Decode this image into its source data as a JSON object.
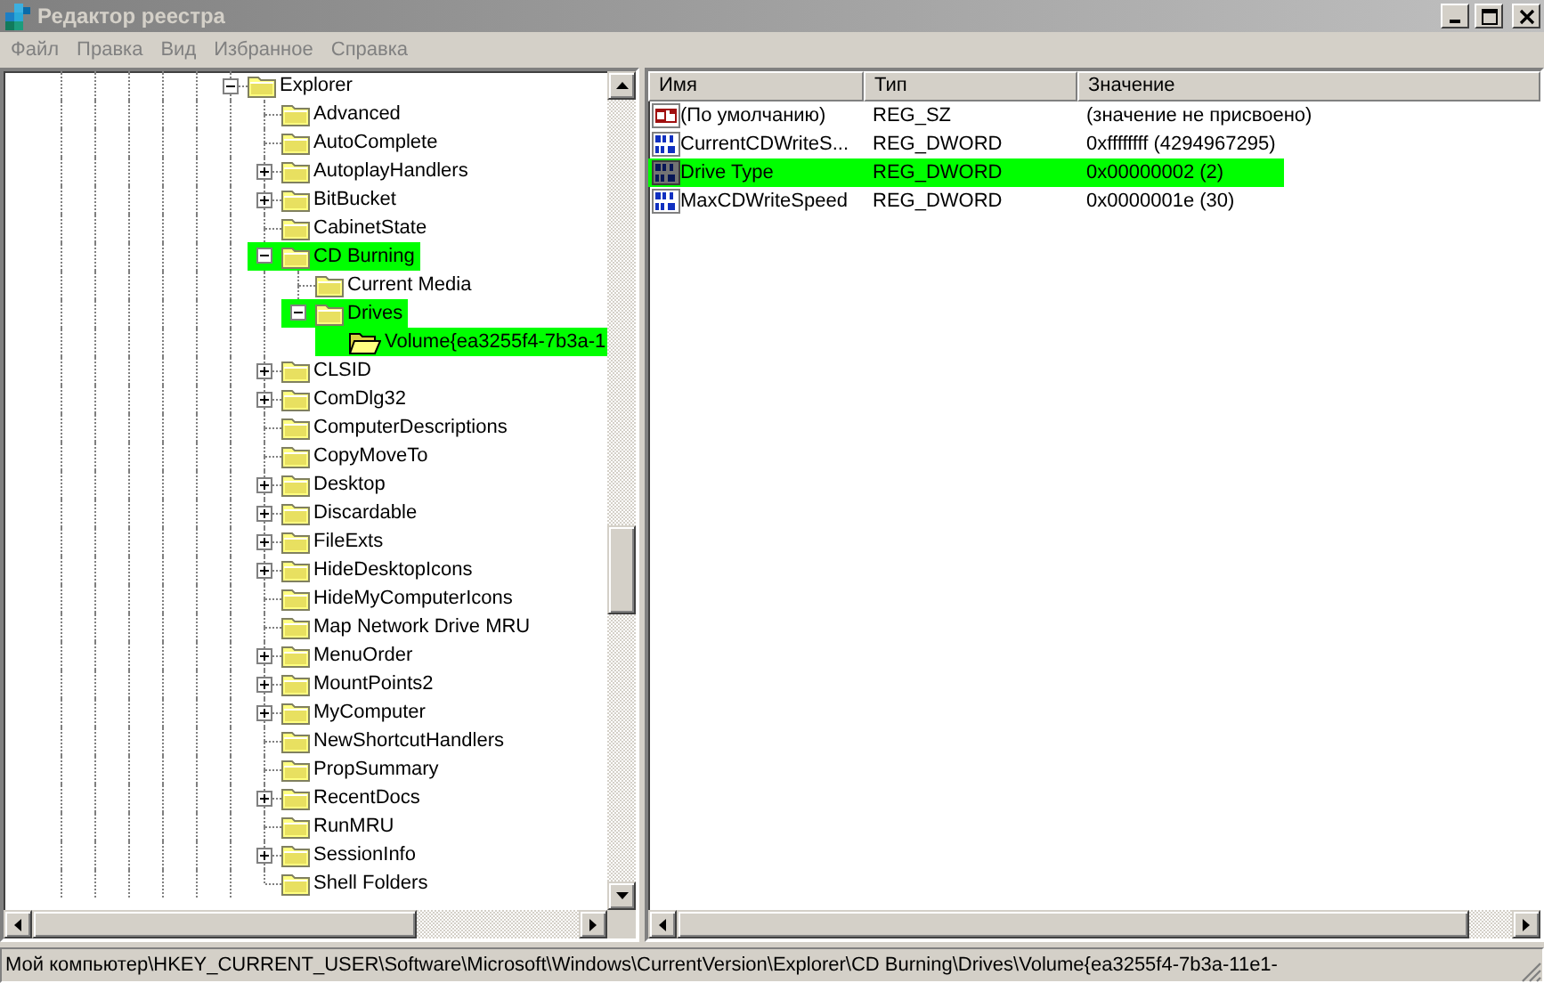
{
  "window": {
    "title": "Редактор реестра",
    "active": false
  },
  "menu": [
    "Файл",
    "Правка",
    "Вид",
    "Избранное",
    "Справка"
  ],
  "tree": {
    "items": [
      {
        "label": "Explorer",
        "has_children": true,
        "expanded": true,
        "selected": false,
        "highlighted": false,
        "children": [
          {
            "label": "Advanced",
            "has_children": false,
            "selected": false,
            "highlighted": false
          },
          {
            "label": "AutoComplete",
            "has_children": false,
            "selected": false,
            "highlighted": false
          },
          {
            "label": "AutoplayHandlers",
            "has_children": true,
            "expanded": false,
            "selected": false,
            "highlighted": false
          },
          {
            "label": "BitBucket",
            "has_children": true,
            "expanded": false,
            "selected": false,
            "highlighted": false
          },
          {
            "label": "CabinetState",
            "has_children": false,
            "selected": false,
            "highlighted": false
          },
          {
            "label": "CD Burning",
            "has_children": true,
            "expanded": true,
            "selected": false,
            "highlighted": true,
            "children": [
              {
                "label": "Current Media",
                "has_children": false,
                "selected": false,
                "highlighted": false
              },
              {
                "label": "Drives",
                "has_children": true,
                "expanded": true,
                "selected": false,
                "highlighted": true,
                "children": [
                  {
                    "label": "Volume{ea3255f4-7b3a-1",
                    "has_children": false,
                    "selected": true,
                    "highlighted": true
                  }
                ]
              }
            ]
          },
          {
            "label": "CLSID",
            "has_children": true,
            "expanded": false,
            "selected": false,
            "highlighted": false
          },
          {
            "label": "ComDlg32",
            "has_children": true,
            "expanded": false,
            "selected": false,
            "highlighted": false
          },
          {
            "label": "ComputerDescriptions",
            "has_children": false,
            "selected": false,
            "highlighted": false
          },
          {
            "label": "CopyMoveTo",
            "has_children": false,
            "selected": false,
            "highlighted": false
          },
          {
            "label": "Desktop",
            "has_children": true,
            "expanded": false,
            "selected": false,
            "highlighted": false
          },
          {
            "label": "Discardable",
            "has_children": true,
            "expanded": false,
            "selected": false,
            "highlighted": false
          },
          {
            "label": "FileExts",
            "has_children": true,
            "expanded": false,
            "selected": false,
            "highlighted": false
          },
          {
            "label": "HideDesktopIcons",
            "has_children": true,
            "expanded": false,
            "selected": false,
            "highlighted": false
          },
          {
            "label": "HideMyComputerIcons",
            "has_children": false,
            "selected": false,
            "highlighted": false
          },
          {
            "label": "Map Network Drive MRU",
            "has_children": false,
            "selected": false,
            "highlighted": false
          },
          {
            "label": "MenuOrder",
            "has_children": true,
            "expanded": false,
            "selected": false,
            "highlighted": false
          },
          {
            "label": "MountPoints2",
            "has_children": true,
            "expanded": false,
            "selected": false,
            "highlighted": false
          },
          {
            "label": "MyComputer",
            "has_children": true,
            "expanded": false,
            "selected": false,
            "highlighted": false
          },
          {
            "label": "NewShortcutHandlers",
            "has_children": false,
            "selected": false,
            "highlighted": false
          },
          {
            "label": "PropSummary",
            "has_children": false,
            "selected": false,
            "highlighted": false
          },
          {
            "label": "RecentDocs",
            "has_children": true,
            "expanded": false,
            "selected": false,
            "highlighted": false
          },
          {
            "label": "RunMRU",
            "has_children": false,
            "selected": false,
            "highlighted": false
          },
          {
            "label": "SessionInfo",
            "has_children": true,
            "expanded": false,
            "selected": false,
            "highlighted": false
          },
          {
            "label": "Shell Folders",
            "has_children": false,
            "selected": false,
            "highlighted": false
          }
        ]
      }
    ]
  },
  "values": {
    "columns": [
      "Имя",
      "Тип",
      "Значение"
    ],
    "rows": [
      {
        "kind": "string",
        "name": "(По умолчанию)",
        "type": "REG_SZ",
        "data": "(значение не присвоено)",
        "highlighted": false
      },
      {
        "kind": "dword",
        "name": "CurrentCDWriteS...",
        "type": "REG_DWORD",
        "data": "0xffffffff (4294967295)",
        "highlighted": false
      },
      {
        "kind": "dword",
        "name": "Drive Type",
        "type": "REG_DWORD",
        "data": "0x00000002 (2)",
        "highlighted": true
      },
      {
        "kind": "dword",
        "name": "MaxCDWriteSpeed",
        "type": "REG_DWORD",
        "data": "0x0000001e (30)",
        "highlighted": false
      }
    ]
  },
  "status_bar": "Мой компьютер\\HKEY_CURRENT_USER\\Software\\Microsoft\\Windows\\CurrentVersion\\Explorer\\CD Burning\\Drives\\Volume{ea3255f4-7b3a-11e1-"
}
